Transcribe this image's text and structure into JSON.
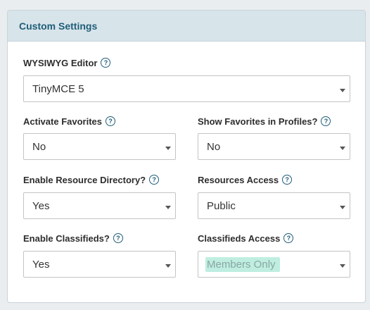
{
  "panel": {
    "title": "Custom Settings"
  },
  "fields": {
    "wysiwyg": {
      "label": "WYSIWYG Editor",
      "value": "TinyMCE 5"
    },
    "activate_favorites": {
      "label": "Activate Favorites",
      "value": "No"
    },
    "show_favorites": {
      "label": "Show Favorites in Profiles?",
      "value": "No"
    },
    "enable_resources": {
      "label": "Enable Resource Directory?",
      "value": "Yes"
    },
    "resources_access": {
      "label": "Resources Access",
      "value": "Public"
    },
    "enable_classifieds": {
      "label": "Enable Classifieds?",
      "value": "Yes"
    },
    "classifieds_access": {
      "label": "Classifieds Access",
      "value": "Members Only"
    }
  },
  "icons": {
    "help": "?"
  },
  "colors": {
    "accent": "#1f5d78",
    "header_bg": "#d7e4ea",
    "highlight": "#bfeee0"
  }
}
